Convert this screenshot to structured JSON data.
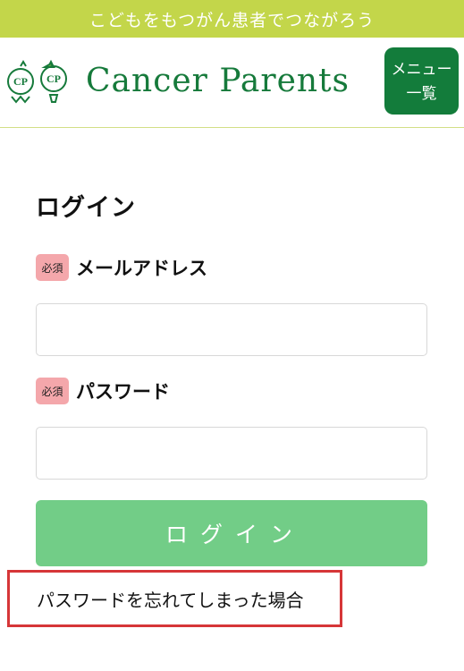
{
  "banner": {
    "text": "こどもをもつがん患者でつながろう",
    "color": "#c3d64a"
  },
  "header": {
    "logo_text": "Cancer Parents",
    "logo_mark_letters": "CP",
    "brand_color": "#167a3b",
    "menu_button_label": "メニュー一覧"
  },
  "login": {
    "title": "ログイン",
    "required_badge": "必須",
    "email_label": "メールアドレス",
    "email_value": "",
    "password_label": "パスワード",
    "password_value": "",
    "submit_label": "ログイン",
    "forgot_password_link": "パスワードを忘れてしまった場合"
  },
  "colors": {
    "button_green": "#72cd87",
    "badge_pink": "#f4a7ab",
    "highlight_red": "#d63638"
  }
}
